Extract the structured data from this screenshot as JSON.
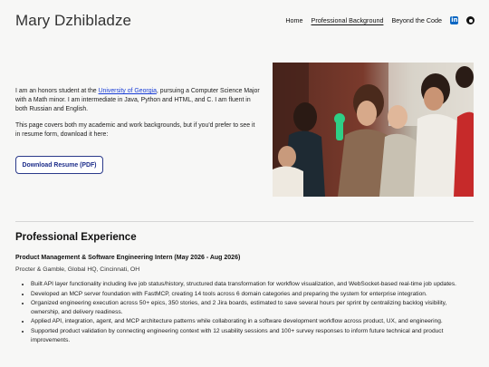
{
  "header": {
    "site_title": "Mary Dzhibladze",
    "nav": [
      {
        "label": "Home"
      },
      {
        "label": "Professional Background"
      },
      {
        "label": "Beyond the Code"
      }
    ],
    "social_icons": [
      "linkedin-icon",
      "github-icon"
    ]
  },
  "intro": {
    "p1_before": "I am an honors student at the ",
    "p1_link": "University of Georgia",
    "p1_after": ", pursuing a Computer Science Major with a Math minor. I am intermediate in Java, Python and HTML, and C. I am fluent in both Russian and English.",
    "p2": "This page covers both my academic and work backgrounds, but if you'd prefer to see it in resume form, download it here:",
    "resume_button": "Download Resume (PDF)"
  },
  "experience": {
    "section_title": "Professional Experience",
    "jobs": [
      {
        "title": "Product Management & Software Engineering Intern (May 2026 - Aug 2026)",
        "org": "Procter & Gamble, Global HQ, Cincinnati, OH",
        "bullets": [
          "Built API layer functionality including live job status/history, structured data transformation for workflow visualization, and WebSocket-based real-time job updates.",
          "Developed an MCP server foundation with FastMCP, creating 14 tools across 6 domain categories and preparing the system for enterprise integration.",
          "Organized engineering execution across 50+ epics, 350 stories, and 2 Jira boards, estimated to save several hours per sprint by centralizing backlog visibility, ownership, and delivery readiness.",
          "Applied API, integration, agent, and MCP architecture patterns while collaborating in a software development workflow across product, UX, and engineering.",
          "Supported product validation by connecting engineering context with 12 usability sessions and 100+ survey responses to inform future technical and product improvements."
        ]
      }
    ]
  },
  "colors": {
    "link": "#1a3ed6",
    "button_text": "#1d2d8a",
    "linkedin": "#0a66c2"
  }
}
